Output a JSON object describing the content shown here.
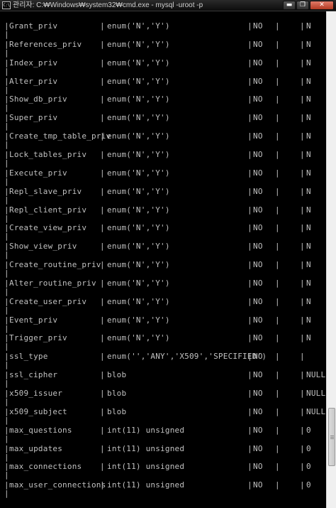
{
  "window": {
    "title": "관리자: C:₩Windows₩system32₩cmd.exe - mysql  -uroot -p",
    "icon_label": "C:\\",
    "buttons": {
      "minimize": "▬",
      "maximize": "❐",
      "close": "✕"
    }
  },
  "columns": {
    "pipe": "|"
  },
  "rows": [
    {
      "field": "Grant_priv",
      "type": "enum('N','Y')",
      "null": "NO",
      "default": "N"
    },
    {
      "field": "References_priv",
      "type": "enum('N','Y')",
      "null": "NO",
      "default": "N"
    },
    {
      "field": "Index_priv",
      "type": "enum('N','Y')",
      "null": "NO",
      "default": "N"
    },
    {
      "field": "Alter_priv",
      "type": "enum('N','Y')",
      "null": "NO",
      "default": "N"
    },
    {
      "field": "Show_db_priv",
      "type": "enum('N','Y')",
      "null": "NO",
      "default": "N"
    },
    {
      "field": "Super_priv",
      "type": "enum('N','Y')",
      "null": "NO",
      "default": "N"
    },
    {
      "field": "Create_tmp_table_priv",
      "type": "enum('N','Y')",
      "null": "NO",
      "default": "N"
    },
    {
      "field": "Lock_tables_priv",
      "type": "enum('N','Y')",
      "null": "NO",
      "default": "N"
    },
    {
      "field": "Execute_priv",
      "type": "enum('N','Y')",
      "null": "NO",
      "default": "N"
    },
    {
      "field": "Repl_slave_priv",
      "type": "enum('N','Y')",
      "null": "NO",
      "default": "N"
    },
    {
      "field": "Repl_client_priv",
      "type": "enum('N','Y')",
      "null": "NO",
      "default": "N"
    },
    {
      "field": "Create_view_priv",
      "type": "enum('N','Y')",
      "null": "NO",
      "default": "N"
    },
    {
      "field": "Show_view_priv",
      "type": "enum('N','Y')",
      "null": "NO",
      "default": "N"
    },
    {
      "field": "Create_routine_priv",
      "type": "enum('N','Y')",
      "null": "NO",
      "default": "N"
    },
    {
      "field": "Alter_routine_priv",
      "type": "enum('N','Y')",
      "null": "NO",
      "default": "N"
    },
    {
      "field": "Create_user_priv",
      "type": "enum('N','Y')",
      "null": "NO",
      "default": "N"
    },
    {
      "field": "Event_priv",
      "type": "enum('N','Y')",
      "null": "NO",
      "default": "N"
    },
    {
      "field": "Trigger_priv",
      "type": "enum('N','Y')",
      "null": "NO",
      "default": "N"
    },
    {
      "field": "ssl_type",
      "type": "enum('','ANY','X509','SPECIFIED')",
      "null": "NO",
      "default": ""
    },
    {
      "field": "ssl_cipher",
      "type": "blob",
      "null": "NO",
      "default": "NULL"
    },
    {
      "field": "x509_issuer",
      "type": "blob",
      "null": "NO",
      "default": "NULL"
    },
    {
      "field": "x509_subject",
      "type": "blob",
      "null": "NO",
      "default": "NULL"
    },
    {
      "field": "max_questions",
      "type": "int(11) unsigned",
      "null": "NO",
      "default": "0"
    },
    {
      "field": "max_updates",
      "type": "int(11) unsigned",
      "null": "NO",
      "default": "0"
    },
    {
      "field": "max_connections",
      "type": "int(11) unsigned",
      "null": "NO",
      "default": "0"
    },
    {
      "field": "max_user_connections",
      "type": "int(11) unsigned",
      "null": "NO",
      "default": "0"
    }
  ],
  "colors": {
    "text": "#c0c0c0",
    "background": "#000000",
    "close_button": "#c8452e"
  }
}
